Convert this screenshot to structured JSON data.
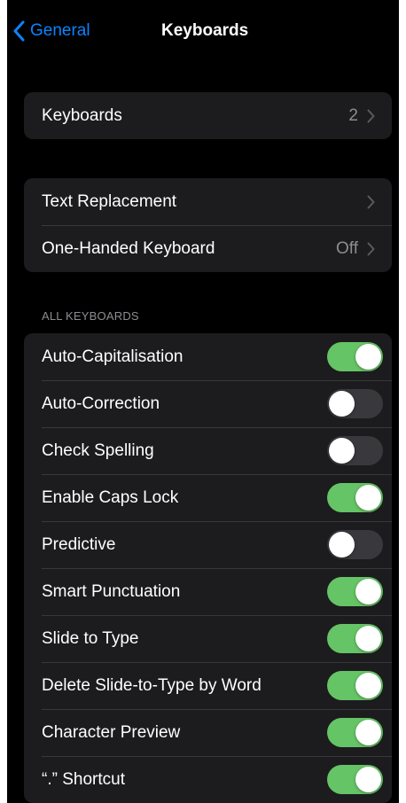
{
  "navbar": {
    "back_label": "General",
    "title": "Keyboards"
  },
  "group1": {
    "rows": [
      {
        "label": "Keyboards",
        "value": "2"
      }
    ]
  },
  "group2": {
    "rows": [
      {
        "label": "Text Replacement",
        "value": ""
      },
      {
        "label": "One-Handed Keyboard",
        "value": "Off"
      }
    ]
  },
  "all_keyboards": {
    "header": "ALL KEYBOARDS",
    "rows": [
      {
        "label": "Auto-Capitalisation",
        "on": true
      },
      {
        "label": "Auto-Correction",
        "on": false
      },
      {
        "label": "Check Spelling",
        "on": false
      },
      {
        "label": "Enable Caps Lock",
        "on": true
      },
      {
        "label": "Predictive",
        "on": false
      },
      {
        "label": "Smart Punctuation",
        "on": true
      },
      {
        "label": "Slide to Type",
        "on": true
      },
      {
        "label": "Delete Slide-to-Type by Word",
        "on": true
      },
      {
        "label": "Character Preview",
        "on": true
      },
      {
        "label": "“.” Shortcut",
        "on": true
      }
    ]
  },
  "colors": {
    "accent": "#0a84ff",
    "toggle_on": "#65c466",
    "toggle_off": "#39393d",
    "cell_background": "#1c1c1e",
    "background": "#000000",
    "secondary_text": "#8d8d92"
  },
  "icons": {
    "back": "chevron-left-icon",
    "disclosure": "chevron-right-icon"
  }
}
